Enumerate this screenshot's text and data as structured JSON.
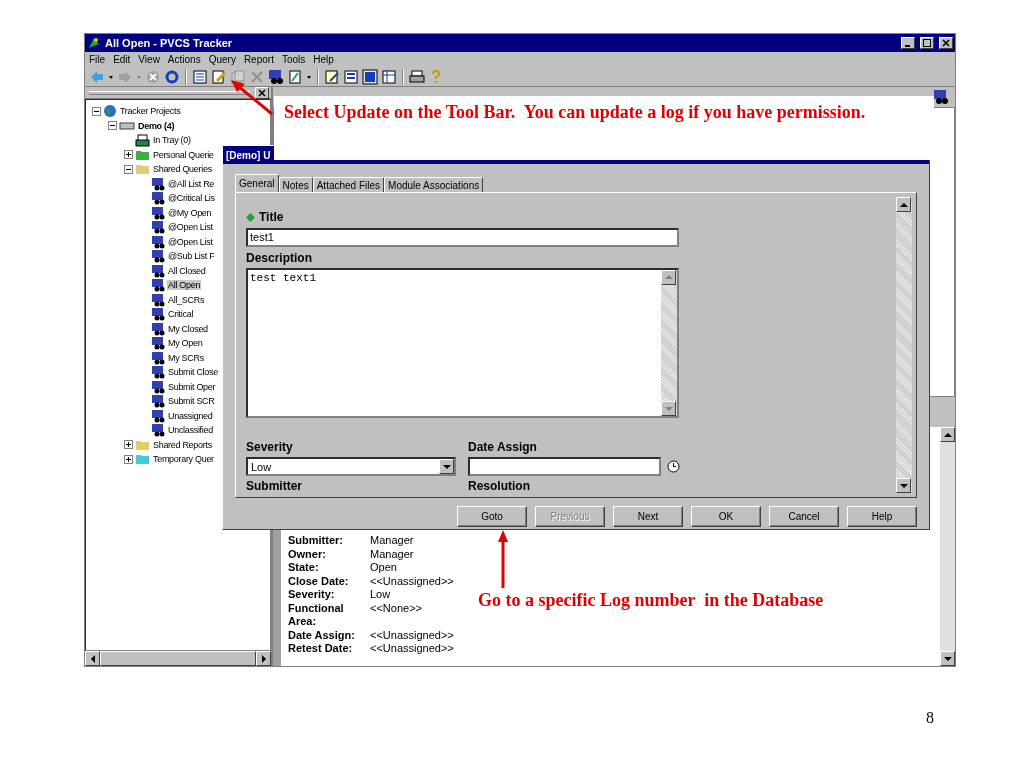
{
  "window": {
    "title": "All Open - PVCS Tracker"
  },
  "menu": [
    "File",
    "Edit",
    "View",
    "Actions",
    "Query",
    "Report",
    "Tools",
    "Help"
  ],
  "tree": [
    {
      "label": "Tracker Projects",
      "kind": "globe",
      "expanded": true,
      "selected": false,
      "children": [
        {
          "label": "Demo (4)",
          "kind": "database",
          "expanded": true,
          "selected": false,
          "children": [
            {
              "label": "In Tray (0)",
              "kind": "tray",
              "selected": false
            },
            {
              "label": "Personal Querie",
              "kind": "folder",
              "color": "#3cb043",
              "expanded": false,
              "selected": false
            },
            {
              "label": "Shared Queries",
              "kind": "folder",
              "color": "#d8cf78",
              "expanded": true,
              "selected": false,
              "children": [
                {
                  "label": "@All List Re",
                  "kind": "query",
                  "selected": false
                },
                {
                  "label": "@Critical Lis",
                  "kind": "query",
                  "selected": false
                },
                {
                  "label": "@My Open",
                  "kind": "query",
                  "selected": false
                },
                {
                  "label": "@Open List",
                  "kind": "query",
                  "selected": false
                },
                {
                  "label": "@Open List",
                  "kind": "query",
                  "selected": false
                },
                {
                  "label": "@Sub List F",
                  "kind": "query",
                  "selected": false
                },
                {
                  "label": "All Closed",
                  "kind": "query",
                  "selected": false
                },
                {
                  "label": "All Open",
                  "kind": "query",
                  "selected": true
                },
                {
                  "label": "All_SCRs",
                  "kind": "query",
                  "selected": false
                },
                {
                  "label": "Critical",
                  "kind": "query",
                  "selected": false
                },
                {
                  "label": "My Closed",
                  "kind": "query",
                  "selected": false
                },
                {
                  "label": "My Open",
                  "kind": "query",
                  "selected": false
                },
                {
                  "label": "My SCRs",
                  "kind": "query",
                  "selected": false
                },
                {
                  "label": "Submit Close",
                  "kind": "query",
                  "selected": false
                },
                {
                  "label": "Submit Oper",
                  "kind": "query",
                  "selected": false
                },
                {
                  "label": "Submit SCR",
                  "kind": "query",
                  "selected": false
                },
                {
                  "label": "Unassigned",
                  "kind": "query",
                  "selected": false
                },
                {
                  "label": "Unclassified",
                  "kind": "query",
                  "selected": false
                }
              ]
            },
            {
              "label": "Shared Reports",
              "kind": "folder",
              "color": "#e0d060",
              "expanded": false,
              "selected": false
            },
            {
              "label": "Temporary Quer",
              "kind": "folder",
              "color": "#48c8d8",
              "expanded": false,
              "selected": false
            }
          ]
        }
      ]
    }
  ],
  "details": [
    {
      "label": "Submitter:",
      "value": "Manager"
    },
    {
      "label": "Owner:",
      "value": "Manager"
    },
    {
      "label": "State:",
      "value": "Open"
    },
    {
      "label": "Close Date:",
      "value": "<<Unassigned>>"
    },
    {
      "label": "Severity:",
      "value": "Low"
    },
    {
      "label": "Functional Area:",
      "value": "<<None>>"
    },
    {
      "label": "Date Assign:",
      "value": "<<Unassigned>>"
    },
    {
      "label": "Retest Date:",
      "value": "<<Unassigned>>"
    }
  ],
  "dialog": {
    "title": "[Demo] U",
    "tabs": [
      {
        "label": "General",
        "selected": true
      },
      {
        "label": "Notes",
        "selected": false
      },
      {
        "label": "Attached Files",
        "selected": false
      },
      {
        "label": "Module Associations",
        "selected": false
      }
    ],
    "title_label": "Title",
    "title_value": "test1",
    "description_label": "Description",
    "description_value": "test text1",
    "severity_label": "Severity",
    "severity_value": "Low",
    "date_assign_label": "Date Assign",
    "submitter_label": "Submitter",
    "resolution_label": "Resolution",
    "buttons": [
      {
        "label": "Goto",
        "disabled": false
      },
      {
        "label": "Previous",
        "disabled": true
      },
      {
        "label": "Next",
        "disabled": false
      },
      {
        "label": "OK",
        "disabled": false
      },
      {
        "label": "Cancel",
        "disabled": false
      },
      {
        "label": "Help",
        "disabled": false
      }
    ]
  },
  "callouts": [
    {
      "text": "Select Update on the Tool Bar.  You can update a log if you have permission."
    },
    {
      "text": "Go to a specific Log number  in the Database"
    }
  ],
  "page_number": "8"
}
